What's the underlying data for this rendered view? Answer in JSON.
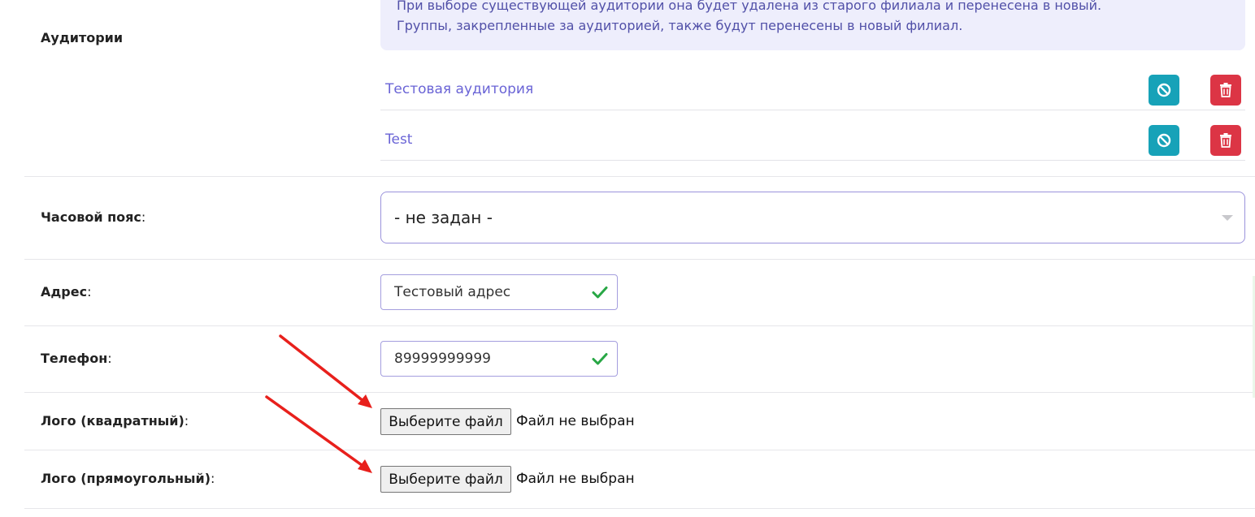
{
  "auditories": {
    "label": "Аудитории",
    "info": {
      "line1": "При выборе существующей аудитории она будет удалена из старого филиала и перенесена в новый.",
      "line2": "Группы, закрепленные за аудиторией, также будут перенесены в новый филиал."
    },
    "items": [
      {
        "name": "Тестовая аудитория",
        "block_icon": "ban-icon",
        "delete_icon": "trash-icon"
      },
      {
        "name": "Test",
        "block_icon": "ban-icon",
        "delete_icon": "trash-icon"
      }
    ]
  },
  "timezone": {
    "label": "Часовой пояс",
    "value": "- не задан -"
  },
  "address": {
    "label": "Адрес",
    "value": "Тестовый адрес"
  },
  "phone": {
    "label": "Телефон",
    "value": "89999999999"
  },
  "logo_square": {
    "label": "Лого (квадратный)",
    "button": "Выберите файл",
    "status": "Файл не выбран"
  },
  "logo_rect": {
    "label": "Лого (прямоугольный)",
    "button": "Выберите файл",
    "status": "Файл не выбран"
  },
  "colors": {
    "accent": "#6a64d6",
    "info": "#17a2b8",
    "danger": "#dc3545",
    "success": "#28a745",
    "annotation": "#e8201c"
  }
}
